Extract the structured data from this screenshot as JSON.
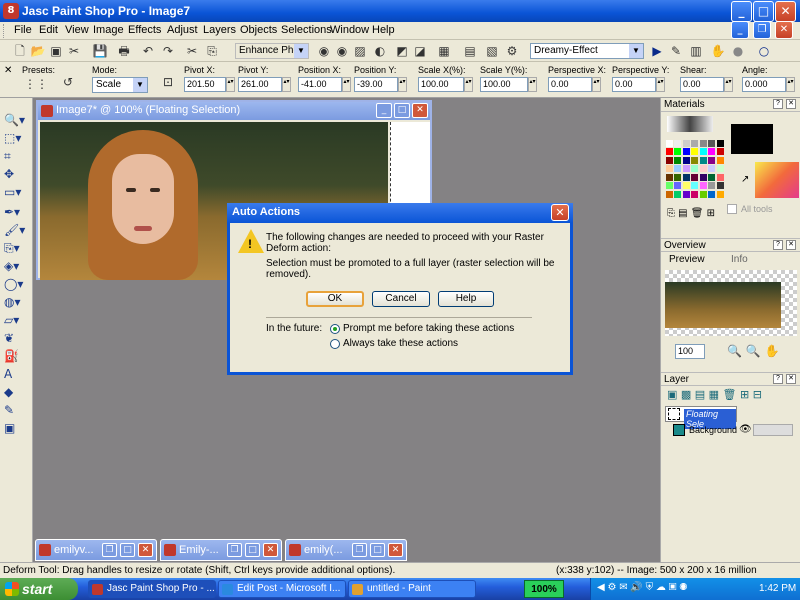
{
  "window": {
    "title": "Jasc Paint Shop Pro - Image7",
    "app_icon": "8"
  },
  "menu": [
    "File",
    "Edit",
    "View",
    "Image",
    "Effects",
    "Adjust",
    "Layers",
    "Objects",
    "Selections",
    "Window",
    "Help"
  ],
  "toolbar": {
    "script_combo": "Enhance Photo",
    "effect_combo": "Dreamy-Effect"
  },
  "tool_options": {
    "presets_label": "Presets:",
    "mode_label": "Mode:",
    "mode_value": "Scale",
    "pivot_x_label": "Pivot X:",
    "pivot_x": "201.50",
    "pivot_y_label": "Pivot Y:",
    "pivot_y": "261.00",
    "position_x_label": "Position X:",
    "position_x": "-41.00",
    "position_y_label": "Position Y:",
    "position_y": "-39.00",
    "scale_x_label": "Scale X(%):",
    "scale_x": "100.00",
    "scale_y_label": "Scale Y(%):",
    "scale_y": "100.00",
    "persp_x_label": "Perspective X:",
    "persp_x": "0.00",
    "persp_y_label": "Perspective Y:",
    "persp_y": "0.00",
    "shear_label": "Shear:",
    "shear": "0.00",
    "angle_label": "Angle:",
    "angle": "0.000"
  },
  "image_window": {
    "title": "Image7* @ 100% (Floating Selection)"
  },
  "minimized": [
    "emilyv...",
    "Emily-...",
    "emily(..."
  ],
  "dialog": {
    "title": "Auto Actions",
    "message": "The following changes are needed to proceed with your Raster Deform action:",
    "detail": "Selection must be promoted to a full layer (raster selection will be removed).",
    "ok": "OK",
    "cancel": "Cancel",
    "help": "Help",
    "future_label": "In the future:",
    "option1": "Prompt me before taking these actions",
    "option2": "Always take these actions"
  },
  "materials": {
    "title": "Materials",
    "all_tools": "All tools"
  },
  "overview": {
    "title": "Overview",
    "tab_preview": "Preview",
    "tab_info": "Info",
    "zoom": "100"
  },
  "layers": {
    "title": "Layer",
    "items": [
      "Floating Sele",
      "Background"
    ]
  },
  "status": {
    "left": "Deform Tool: Drag handles to resize or rotate (Shift, Ctrl keys provide additional options).",
    "right": "(x:338 y:102) -- Image:  500 x 200 x 16 million"
  },
  "taskbar": {
    "start": "start",
    "tasks": [
      "Jasc Paint Shop Pro - ...",
      "Edit Post - Microsoft I...",
      "untitled - Paint"
    ],
    "battery": "100%",
    "clock": "1:42 PM"
  }
}
